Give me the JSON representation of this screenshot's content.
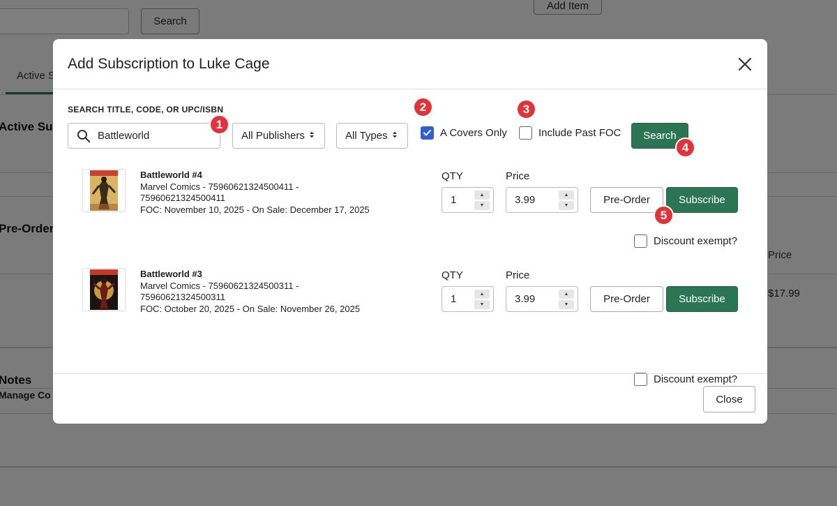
{
  "background": {
    "search_button": "Search",
    "add_item_button": "Add Item",
    "tab_active": "Active S",
    "heading_active": "Active Sub",
    "heading_preorder": "Pre-Order",
    "heading_notes": "Notes",
    "sub_manage": "Manage Co",
    "price_header": "Price",
    "price_value": "$17.99"
  },
  "modal": {
    "title": "Add Subscription to Luke Cage",
    "search_label": "SEARCH TITLE, CODE, OR UPC/ISBN",
    "search_value": "Battleworld",
    "publisher_select": "All Publishers",
    "type_select": "All Types",
    "a_covers_only": {
      "label": "A Covers Only",
      "checked": true
    },
    "include_past_foc": {
      "label": "Include Past FOC",
      "checked": false
    },
    "search_button": "Search",
    "close_button": "Close",
    "results": [
      {
        "title": "Battleworld #4",
        "line1": "Marvel Comics - 75960621324500411 -",
        "line2": "75960621324500411",
        "line3": "FOC: November 10, 2025 -  On Sale: December 17, 2025",
        "qty_label": "QTY",
        "qty": "1",
        "price_label": "Price",
        "price": "3.99",
        "preorder_label": "Pre-Order",
        "subscribe_label": "Subscribe",
        "discount_label": "Discount exempt?"
      },
      {
        "title": "Battleworld #3",
        "line1": "Marvel Comics - 75960621324500311 -",
        "line2": "75960621324500311",
        "line3": "FOC: October 20, 2025 -  On Sale: November 26, 2025",
        "qty_label": "QTY",
        "qty": "1",
        "price_label": "Price",
        "price": "3.99",
        "preorder_label": "Pre-Order",
        "subscribe_label": "Subscribe",
        "discount_label": "Discount exempt?"
      }
    ]
  },
  "annotations": [
    "1",
    "2",
    "3",
    "4",
    "5"
  ],
  "colors": {
    "accent_green": "#2b7554",
    "checkbox_blue": "#2f5fd0",
    "badge_red": "#e2323a"
  }
}
